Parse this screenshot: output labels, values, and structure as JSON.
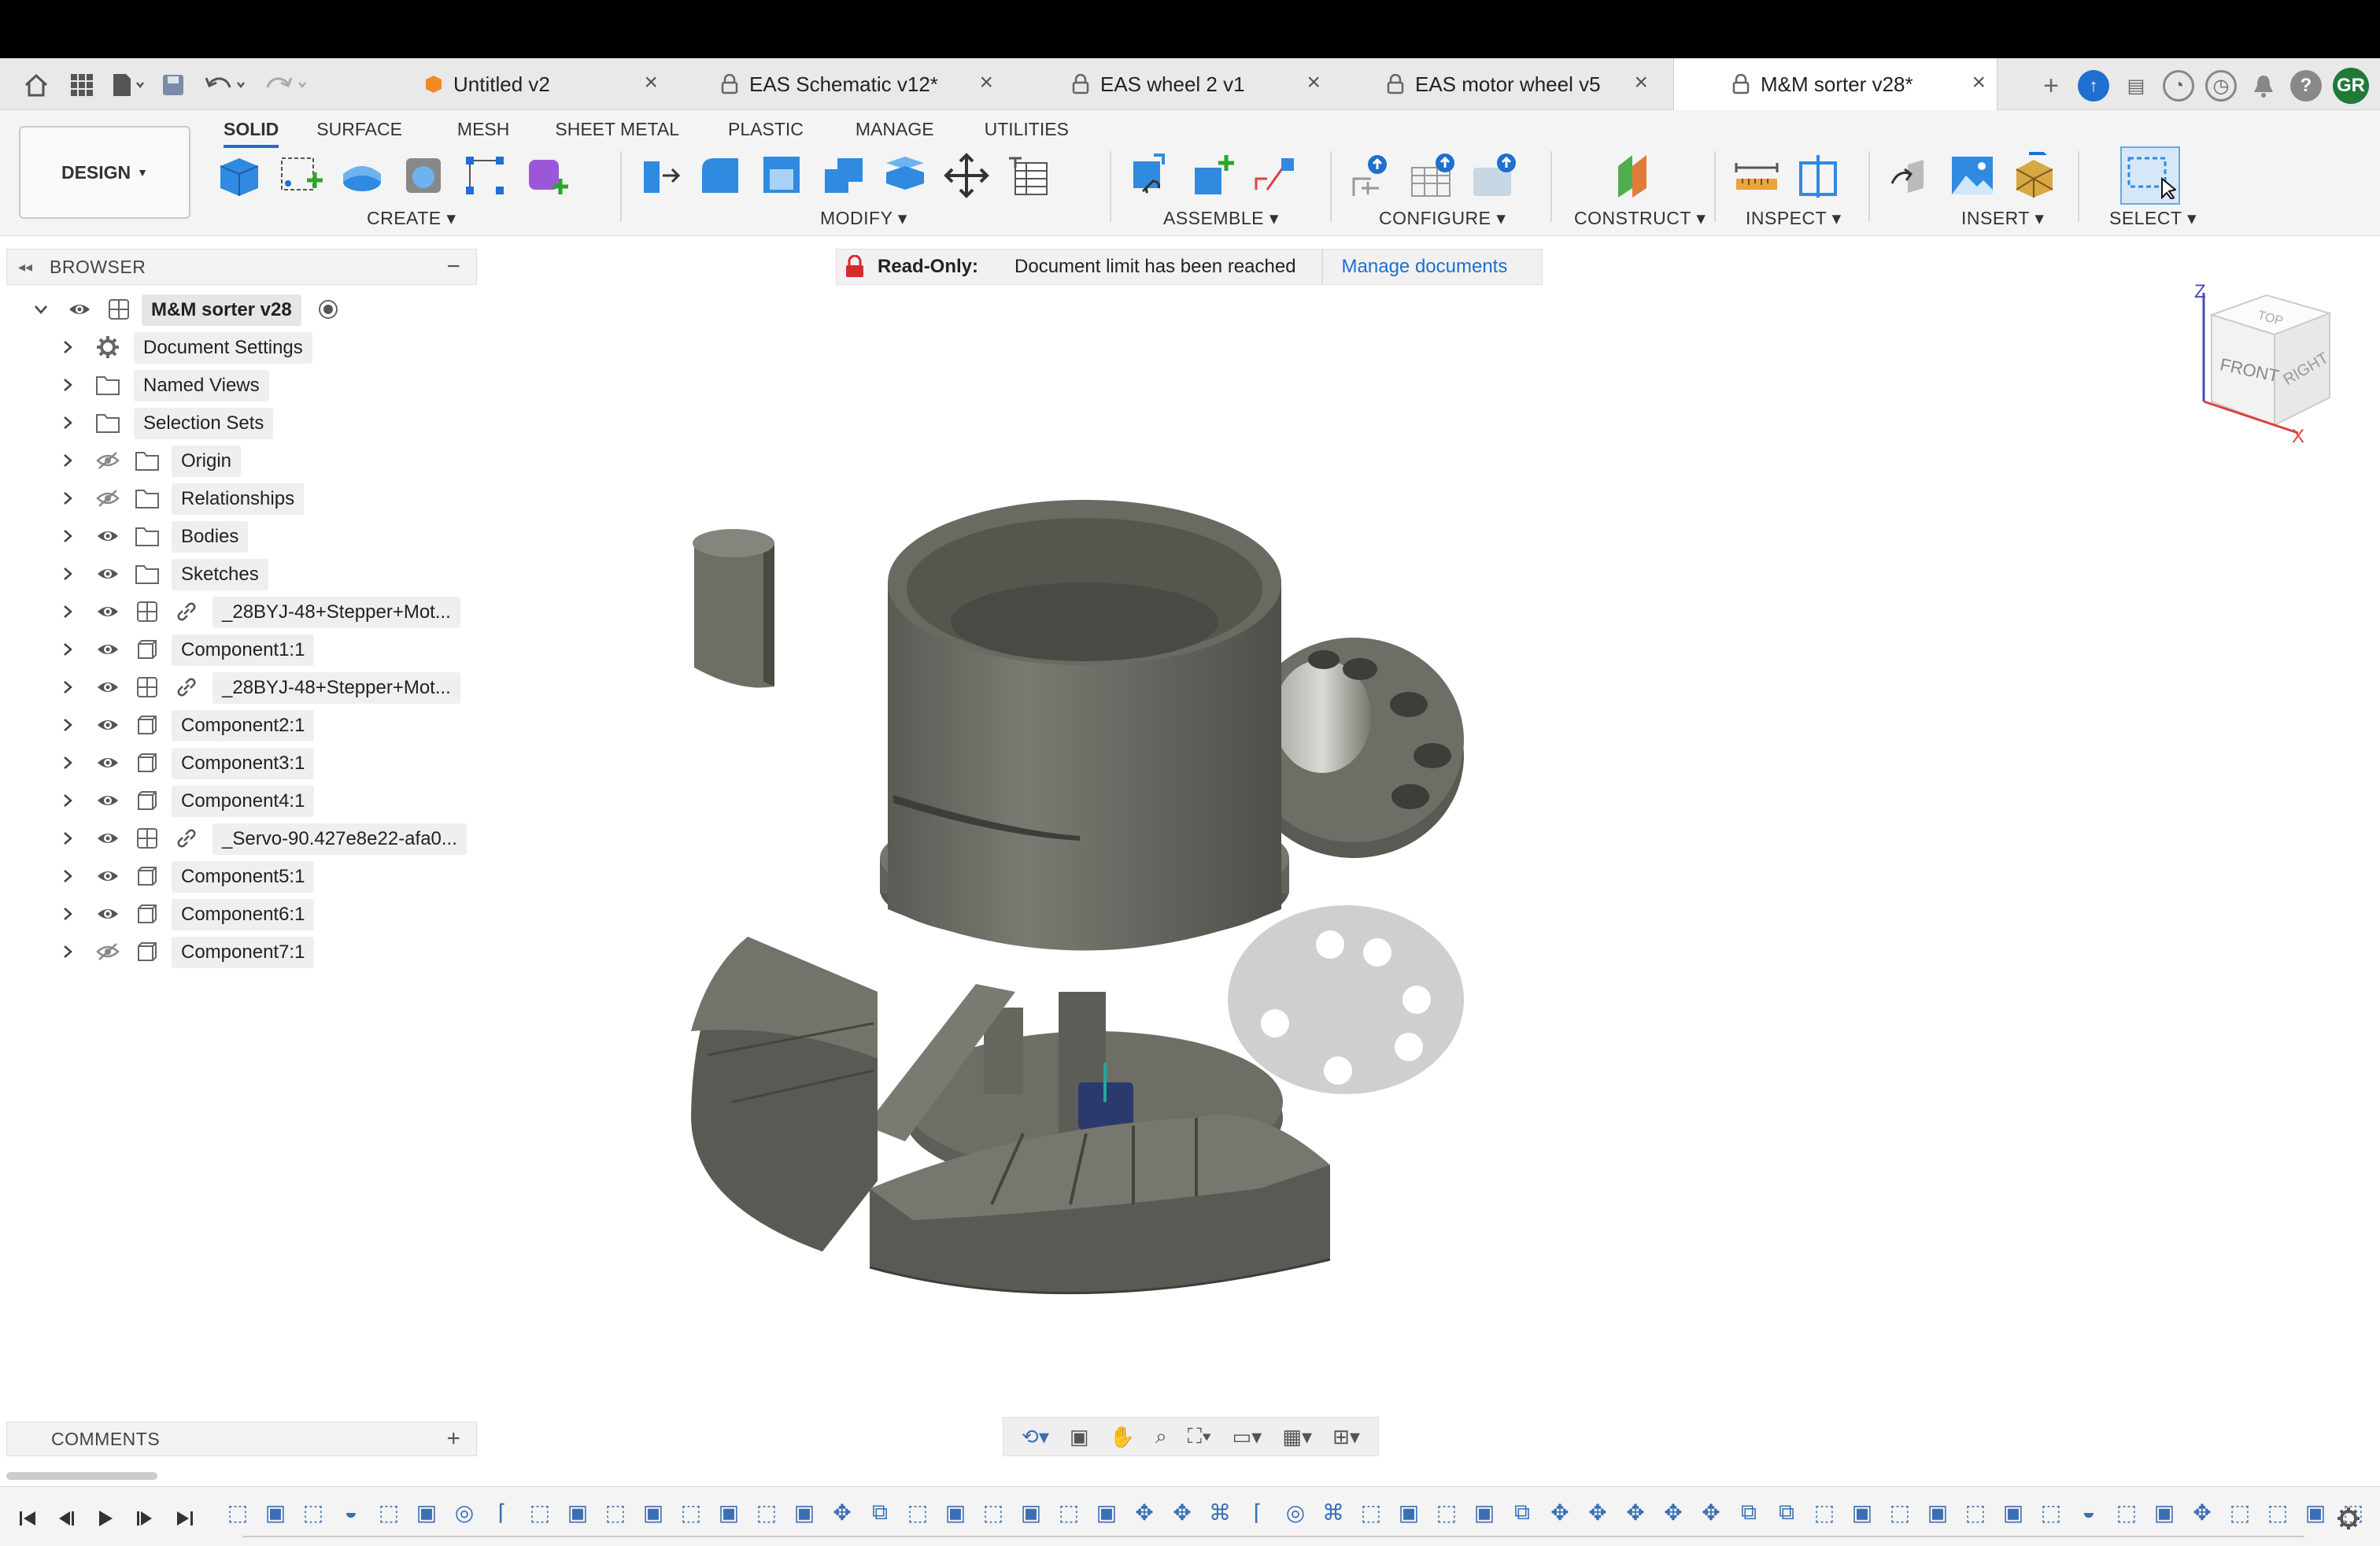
{
  "tabs": [
    {
      "title": "Untitled v2",
      "locked": false
    },
    {
      "title": "EAS Schematic v12*",
      "locked": true
    },
    {
      "title": "EAS wheel 2 v1",
      "locked": true
    },
    {
      "title": "EAS motor wheel v5",
      "locked": true
    },
    {
      "title": "M&M sorter v28*",
      "locked": true,
      "active": true
    }
  ],
  "user": {
    "initials": "GR"
  },
  "workspace": {
    "label": "DESIGN"
  },
  "ribbon_tabs": [
    "SOLID",
    "SURFACE",
    "MESH",
    "SHEET METAL",
    "PLASTIC",
    "MANAGE",
    "UTILITIES"
  ],
  "ribbon_groups": [
    "CREATE",
    "MODIFY",
    "ASSEMBLE",
    "CONFIGURE",
    "CONSTRUCT",
    "INSPECT",
    "INSERT",
    "SELECT"
  ],
  "browser": {
    "title": "BROWSER",
    "root": "M&M sorter v28",
    "items": [
      {
        "label": "Document Settings",
        "icon": "gear-icon",
        "vis": "none"
      },
      {
        "label": "Named Views",
        "icon": "folder-icon",
        "vis": "none"
      },
      {
        "label": "Selection Sets",
        "icon": "folder-icon",
        "vis": "none"
      },
      {
        "label": "Origin",
        "icon": "folder-icon",
        "vis": "hidden"
      },
      {
        "label": "Relationships",
        "icon": "folder-icon",
        "vis": "hidden"
      },
      {
        "label": "Bodies",
        "icon": "folder-icon",
        "vis": "visible"
      },
      {
        "label": "Sketches",
        "icon": "folder-icon",
        "vis": "visible"
      },
      {
        "label": "_28BYJ-48+Stepper+Mot...",
        "icon": "linked-component-icon",
        "vis": "visible"
      },
      {
        "label": "Component1:1",
        "icon": "component-icon",
        "vis": "visible"
      },
      {
        "label": "_28BYJ-48+Stepper+Mot...",
        "icon": "linked-component-icon",
        "vis": "visible"
      },
      {
        "label": "Component2:1",
        "icon": "component-icon",
        "vis": "visible"
      },
      {
        "label": "Component3:1",
        "icon": "component-icon",
        "vis": "visible"
      },
      {
        "label": "Component4:1",
        "icon": "component-icon",
        "vis": "visible"
      },
      {
        "label": "_Servo-90.427e8e22-afa0...",
        "icon": "linked-component-icon",
        "vis": "visible"
      },
      {
        "label": "Component5:1",
        "icon": "component-icon",
        "vis": "visible"
      },
      {
        "label": "Component6:1",
        "icon": "component-icon",
        "vis": "visible"
      },
      {
        "label": "Component7:1",
        "icon": "component-icon",
        "vis": "hidden"
      }
    ]
  },
  "banner": {
    "title": "Read-Only:",
    "message": "Document limit has been reached",
    "link": "Manage documents"
  },
  "comments": {
    "title": "COMMENTS"
  },
  "viewcube": {
    "top": "TOP",
    "front": "FRONT",
    "right": "RIGHT",
    "z": "Z",
    "x": "X"
  },
  "colors": {
    "accent": "#1e6fd0",
    "lock": "#d62b2b",
    "avatar": "#1f7a3a",
    "model": "#6a6a64"
  }
}
